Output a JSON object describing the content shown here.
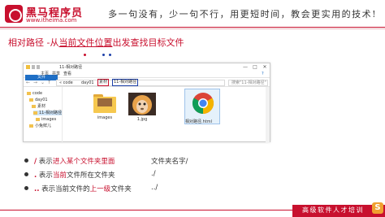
{
  "brand": {
    "name": "黑马程序员",
    "url": "www.itheima.com",
    "slogan": "多一句没有，少一句不行，用更短时间，教会更实用的技术!",
    "color": "#c8102e"
  },
  "heading": {
    "prefix": "相对路径 -从",
    "highlight": "当前文件位置",
    "suffix": "出发查找目标文件"
  },
  "explorer": {
    "window_title": "11-相对路径",
    "title_icons": [
      "folder-icon"
    ],
    "window_buttons": [
      "—",
      "□",
      "✕"
    ],
    "ribbon_tabs": [
      "文件",
      "主页",
      "共享",
      "查看"
    ],
    "address": {
      "prefix": "« code",
      "crumb1": "day01",
      "crumb2": "素材",
      "crumb3": "11-相对路径"
    },
    "search_placeholder": "搜索\"11-相对路径\"",
    "dot_colors": [
      "#c8102e",
      "#1c3fa8",
      "#1c3fa8"
    ],
    "tree": [
      {
        "label": "code",
        "selected": false
      },
      {
        "label": "day01",
        "selected": false
      },
      {
        "label": "素材",
        "selected": false
      },
      {
        "label": "11-相对路径",
        "selected": true
      },
      {
        "label": "images",
        "selected": false
      },
      {
        "label": "小兔鲜儿",
        "selected": false
      }
    ],
    "files": [
      {
        "name": "images",
        "type": "folder"
      },
      {
        "name": "1.jpg",
        "type": "image"
      },
      {
        "name": "相对路径.html",
        "type": "html"
      }
    ]
  },
  "bullets": [
    {
      "sym": "/",
      "pre": " 表示",
      "hl": "进入某个文件夹里面",
      "post": "",
      "note": "文件夹名字/"
    },
    {
      "sym": ".",
      "pre": " 表示",
      "hl": "当前",
      "post": "文件所在文件夹",
      "note": "./"
    },
    {
      "sym": "..",
      "pre": " 表示当前文件的",
      "hl": "上一级",
      "post": "文件夹",
      "note": "../"
    }
  ],
  "footer": {
    "text": "高级软件人才培训",
    "badge": "S"
  }
}
